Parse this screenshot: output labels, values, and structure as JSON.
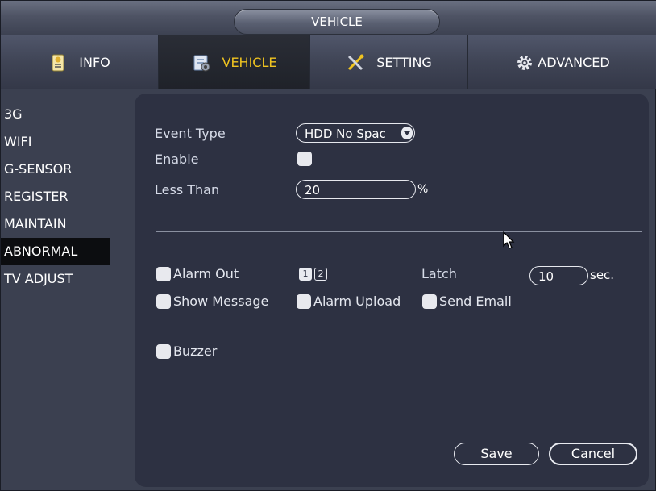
{
  "window": {
    "title": "VEHICLE"
  },
  "tabs": [
    {
      "label": "INFO",
      "icon": "info-icon",
      "active": false
    },
    {
      "label": "VEHICLE",
      "icon": "vehicle-icon",
      "active": true
    },
    {
      "label": "SETTING",
      "icon": "setting-icon",
      "active": false
    },
    {
      "label": "ADVANCED",
      "icon": "advanced-gear-icon",
      "active": false
    }
  ],
  "sidebar": {
    "items": [
      {
        "label": "3G"
      },
      {
        "label": "WIFI"
      },
      {
        "label": "G-SENSOR"
      },
      {
        "label": "REGISTER"
      },
      {
        "label": "MAINTAIN"
      },
      {
        "label": "ABNORMAL",
        "active": true
      },
      {
        "label": "TV ADJUST"
      }
    ]
  },
  "form": {
    "event_type_label": "Event Type",
    "event_type_value": "HDD No Spac",
    "enable_label": "Enable",
    "enable_checked": false,
    "less_than_label": "Less Than",
    "less_than_value": "20",
    "less_than_unit": "%",
    "alarm_out_label": "Alarm Out",
    "alarm_out_channels": [
      {
        "label": "1",
        "selected": true
      },
      {
        "label": "2",
        "selected": false
      }
    ],
    "latch_label": "Latch",
    "latch_value": "10",
    "latch_unit": "sec.",
    "show_message_label": "Show Message",
    "alarm_upload_label": "Alarm Upload",
    "send_email_label": "Send Email",
    "buzzer_label": "Buzzer"
  },
  "buttons": {
    "save": "Save",
    "cancel": "Cancel"
  },
  "colors": {
    "active_tab_text": "#f0c420",
    "panel_bg": "#2d3142",
    "background": "#3b4050"
  }
}
